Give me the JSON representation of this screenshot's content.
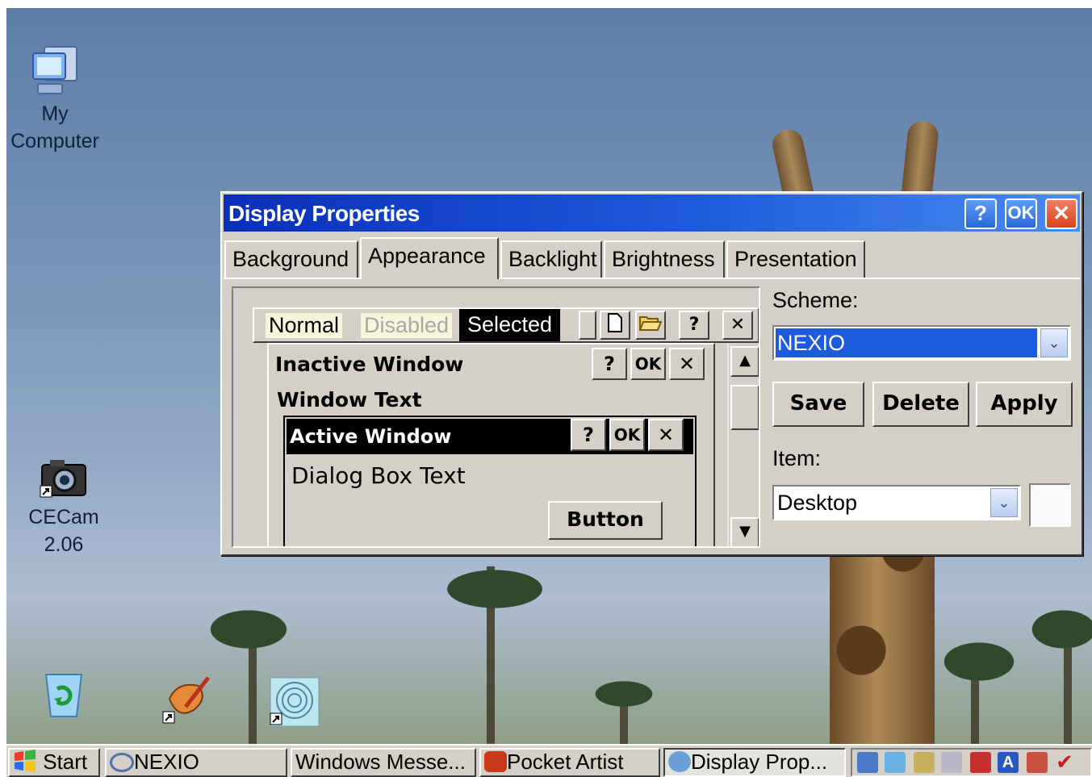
{
  "desktop": {
    "icons": [
      {
        "label_line1": "My",
        "label_line2": "Computer"
      },
      {
        "label_line1": "CECam",
        "label_line2": "2.06"
      },
      {
        "label_line1": "",
        "label_line2": ""
      }
    ]
  },
  "dialog": {
    "title": "Display Properties",
    "title_buttons": {
      "help": "?",
      "ok": "OK",
      "close": "✕"
    },
    "tabs": [
      "Background",
      "Appearance",
      "Backlight",
      "Brightness",
      "Presentation"
    ],
    "active_tab": "Appearance",
    "preview": {
      "menu_normal": "Normal",
      "menu_disabled": "Disabled",
      "menu_selected": "Selected",
      "inactive_window_title": "Inactive Window",
      "window_text": "Window Text",
      "active_window_title": "Active Window",
      "dialog_box_text": "Dialog Box Text",
      "button_label": "Button",
      "caption_help": "?",
      "caption_ok": "OK",
      "caption_close": "✕"
    },
    "scheme": {
      "label": "Scheme:",
      "value": "NEXIO"
    },
    "buttons": {
      "save": "Save",
      "delete": "Delete",
      "apply": "Apply"
    },
    "item": {
      "label": "Item:",
      "value": "Desktop"
    }
  },
  "taskbar": {
    "start": "Start",
    "items": [
      "NEXIO",
      "Windows Messe...",
      "Pocket Artist",
      "Display Prop..."
    ],
    "active_item": "Display Prop..."
  },
  "colors": {
    "titlebar_start": "#0a2fb8",
    "titlebar_end": "#4a8af0",
    "face": "#d4d0c8",
    "selection": "#1e5bdc"
  }
}
